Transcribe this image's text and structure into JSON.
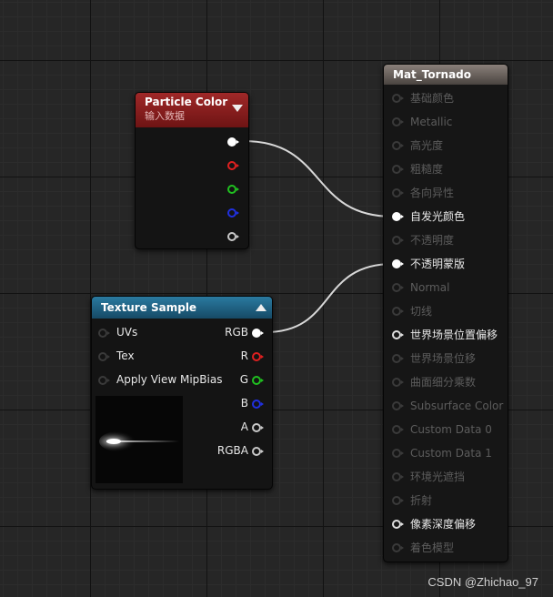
{
  "particle_node": {
    "title": "Particle Color",
    "subtitle": "输入数据",
    "colors": {
      "header": "#8a1e1e",
      "pins": [
        "#ffffff",
        "#e02020",
        "#20c020",
        "#2030e0",
        "#c8c8c8"
      ]
    }
  },
  "texture_node": {
    "title": "Texture Sample",
    "inputs": [
      "UVs",
      "Tex",
      "Apply View MipBias"
    ],
    "outputs": [
      {
        "label": "RGB",
        "color": "#ffffff"
      },
      {
        "label": "R",
        "color": "#e02020"
      },
      {
        "label": "G",
        "color": "#20c020"
      },
      {
        "label": "B",
        "color": "#2030e0"
      },
      {
        "label": "A",
        "color": "#c8c8c8"
      },
      {
        "label": "RGBA",
        "color": "#c8c8c8"
      }
    ],
    "colors": {
      "header": "#1e5a7a"
    }
  },
  "material_node": {
    "title": "Mat_Tornado",
    "inputs": [
      {
        "label": "基础颜色",
        "state": "inactive"
      },
      {
        "label": "Metallic",
        "state": "inactive"
      },
      {
        "label": "高光度",
        "state": "inactive"
      },
      {
        "label": "粗糙度",
        "state": "inactive"
      },
      {
        "label": "各向异性",
        "state": "inactive"
      },
      {
        "label": "自发光颜色",
        "state": "connected"
      },
      {
        "label": "不透明度",
        "state": "inactive"
      },
      {
        "label": "不透明蒙版",
        "state": "connected"
      },
      {
        "label": "Normal",
        "state": "inactive"
      },
      {
        "label": "切线",
        "state": "inactive"
      },
      {
        "label": "世界场景位置偏移",
        "state": "active"
      },
      {
        "label": "世界场景位移",
        "state": "inactive"
      },
      {
        "label": "曲面细分乘数",
        "state": "inactive"
      },
      {
        "label": "Subsurface Color",
        "state": "inactive"
      },
      {
        "label": "Custom Data 0",
        "state": "inactive"
      },
      {
        "label": "Custom Data 1",
        "state": "inactive"
      },
      {
        "label": "环境光遮挡",
        "state": "inactive"
      },
      {
        "label": "折射",
        "state": "inactive"
      },
      {
        "label": "像素深度偏移",
        "state": "active"
      },
      {
        "label": "着色模型",
        "state": "inactive"
      }
    ],
    "colors": {
      "header": "#6e6560"
    }
  },
  "watermark": "CSDN @Zhichao_97",
  "colors": {
    "wire": "#d8d8d8",
    "background": "#262626"
  }
}
